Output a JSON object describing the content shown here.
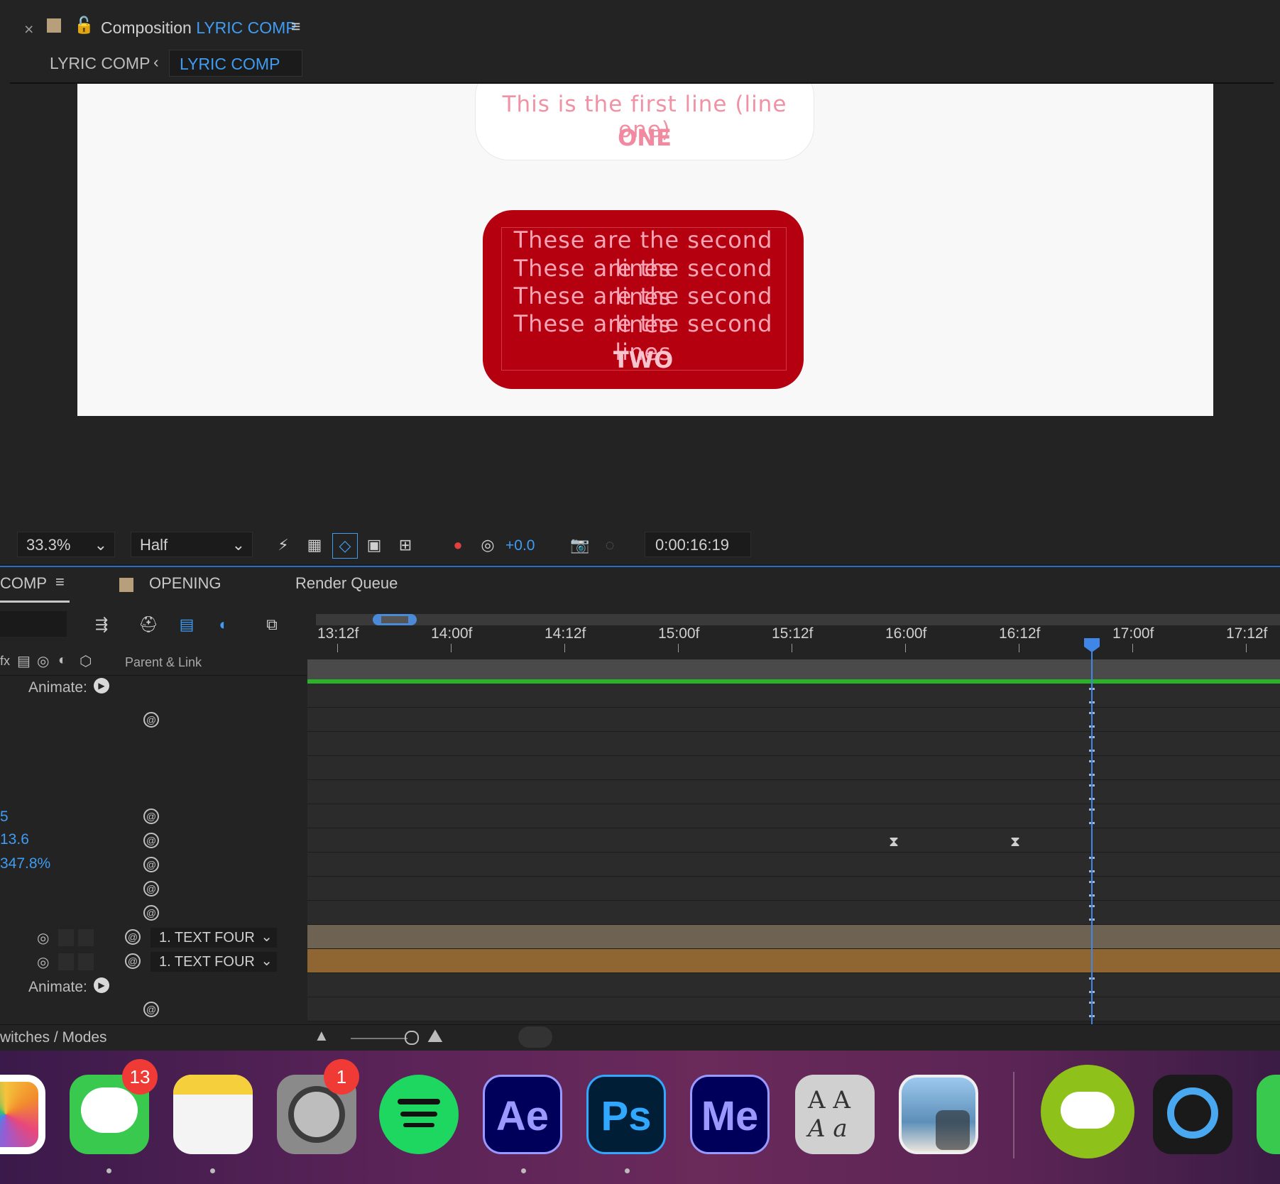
{
  "composition_panel": {
    "title_prefix": "Composition",
    "title_name": "LYRIC COMP",
    "breadcrumb_first": "LYRIC COMP",
    "breadcrumb_active": "LYRIC COMP"
  },
  "canvas": {
    "line_one": "This is the first line (line one)",
    "label_one": "ONE",
    "lines_two": [
      "These are the second lines",
      "These are the second lines",
      "These are the second lines",
      "These are the second lines"
    ],
    "label_two": "TWO",
    "box_two_color": "#b5000f"
  },
  "viewer_toolbar": {
    "zoom": "33.3%",
    "resolution": "Half",
    "exposure": "+0.0",
    "timecode": "0:00:16:19"
  },
  "timeline": {
    "tabs": {
      "comp": "COMP",
      "opening": "OPENING",
      "render_queue": "Render Queue"
    },
    "parent_link_header": "Parent & Link",
    "animate_label": "Animate:",
    "ruler": [
      "13:12f",
      "14:00f",
      "14:12f",
      "15:00f",
      "15:12f",
      "16:00f",
      "16:12f",
      "17:00f",
      "17:12f"
    ],
    "values": {
      "v1": "5",
      "v2": "13.6",
      "v3": "347.8%"
    },
    "parent_dropdowns": [
      "1. TEXT FOUR",
      "1. TEXT FOUR"
    ],
    "switches_modes": "witches / Modes"
  },
  "dock": {
    "messages_badge": "13",
    "settings_badge": "1",
    "after_effects": "Ae",
    "photoshop": "Ps",
    "media_encoder": "Me"
  }
}
